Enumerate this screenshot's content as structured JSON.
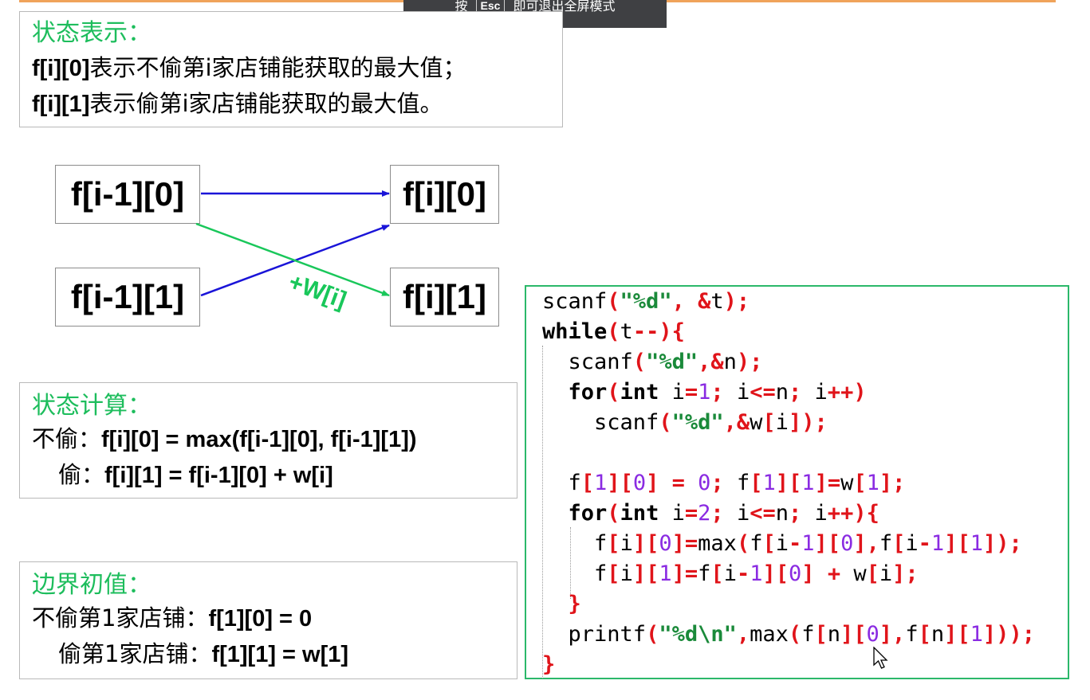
{
  "overlay": {
    "press": "按",
    "key": "Esc",
    "message": "即可退出全屏模式"
  },
  "state_box": {
    "title": "状态表示：",
    "lines": [
      {
        "code": "f[i][0]",
        "text": "表示不偷第i家店铺能获取的最大值；"
      },
      {
        "code": "f[i][1]",
        "text": "表示偷第i家店铺能获取的最大值。"
      }
    ]
  },
  "diagram": {
    "nodes": {
      "prev0": "f[i-1][0]",
      "prev1": "f[i-1][1]",
      "cur0": "f[i][0]",
      "cur1": "f[i][1]"
    },
    "edge_label": "+W[i]",
    "colors": {
      "blue": "#1a14d8",
      "green": "#19c75a"
    }
  },
  "compute_box": {
    "title": "状态计算：",
    "lines": [
      {
        "prefix": "不偷：",
        "formula": "f[i][0] = max(f[i-1][0], f[i-1][1])"
      },
      {
        "prefix": "偷：",
        "formula": "f[i][1] = f[i-1][0] + w[i]"
      }
    ]
  },
  "init_box": {
    "title": "边界初值：",
    "lines": [
      {
        "prefix": "不偷第1家店铺：",
        "formula": "f[1][0] = 0"
      },
      {
        "prefix": "偷第1家店铺：",
        "formula": "f[1][1] = w[1]"
      }
    ]
  },
  "code": {
    "lines": [
      "scanf(\"%d\", &t);",
      "while(t--){",
      "  scanf(\"%d\",&n);",
      "  for(int i=1; i<=n; i++)",
      "    scanf(\"%d\",&w[i]);",
      "",
      "  f[1][0] = 0; f[1][1]=w[1];",
      "  for(int i=2; i<=n; i++){",
      "    f[i][0]=max(f[i-1][0],f[i-1][1]);",
      "    f[i][1]=f[i-1][0] + w[i];",
      "  }",
      "  printf(\"%d\\n\",max(f[n][0],f[n][1]));",
      "}"
    ],
    "colors": {
      "plain": "#000000",
      "punct": "#e0141a",
      "string": "#1a8a3a",
      "number": "#8a2be2",
      "keyword": "#000000"
    }
  }
}
